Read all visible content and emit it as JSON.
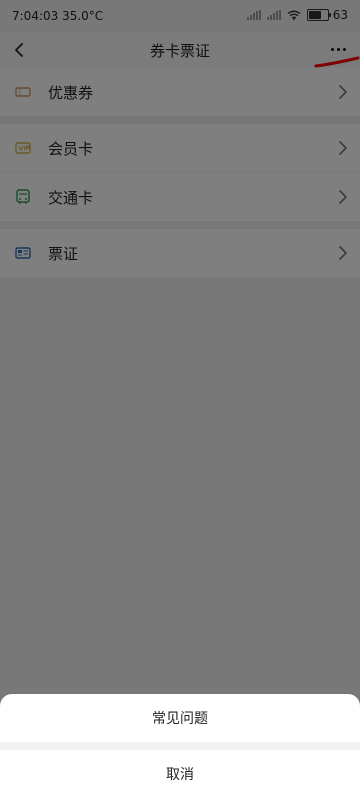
{
  "status": {
    "time": "7:04:03 35.0°C",
    "battery": "63"
  },
  "header": {
    "title": "券卡票证"
  },
  "list": {
    "groups": [
      [
        {
          "label": "优惠券",
          "icon": "coupon-icon"
        }
      ],
      [
        {
          "label": "会员卡",
          "icon": "vip-card-icon"
        },
        {
          "label": "交通卡",
          "icon": "bus-icon"
        }
      ],
      [
        {
          "label": "票证",
          "icon": "ticket-icon"
        }
      ]
    ]
  },
  "sheet": {
    "faq_label": "常见问题",
    "cancel_label": "取消"
  },
  "colors": {
    "overlay": "#000000",
    "annotation": "#ff0000",
    "coupon": "#c89b64",
    "vip": "#d8b34b",
    "bus": "#2f9b5b",
    "ticket": "#2d6db8"
  }
}
